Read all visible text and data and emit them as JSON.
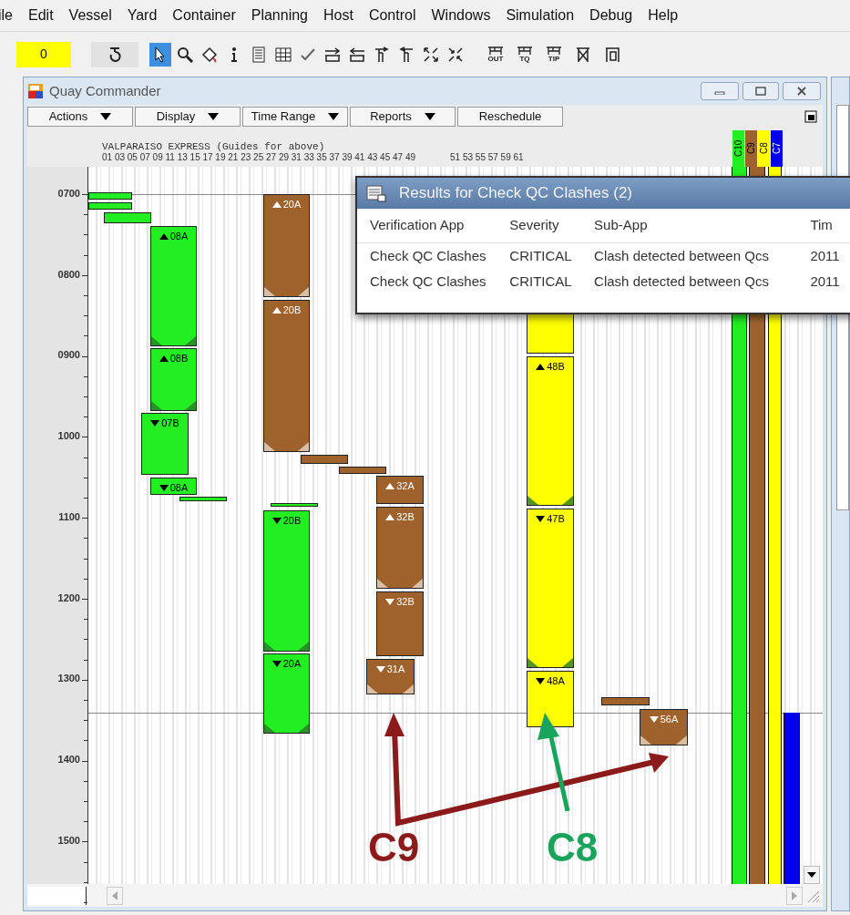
{
  "menu_bar": [
    "ile",
    "Edit",
    "Vessel",
    "Yard",
    "Container",
    "Planning",
    "Host",
    "Control",
    "Windows",
    "Simulation",
    "Debug",
    "Help"
  ],
  "toolbar": {
    "counter": "0",
    "tools": [
      {
        "kind": "pointer",
        "selected": true
      },
      {
        "kind": "search",
        "selected": false
      },
      {
        "kind": "paint",
        "selected": false
      },
      {
        "kind": "info",
        "selected": false
      },
      {
        "kind": "list",
        "selected": false
      },
      {
        "kind": "grid",
        "selected": false
      },
      {
        "kind": "check",
        "selected": false
      },
      {
        "kind": "shift-right",
        "selected": false
      },
      {
        "kind": "shift-left",
        "selected": false
      },
      {
        "kind": "crane-right",
        "selected": false
      },
      {
        "kind": "crane-left",
        "selected": false
      },
      {
        "kind": "expand",
        "selected": false
      },
      {
        "kind": "collapse",
        "selected": false
      },
      {
        "kind": "crane",
        "caption": "OUT",
        "selected": false
      },
      {
        "kind": "crane",
        "caption": "TQ",
        "selected": false
      },
      {
        "kind": "crane",
        "caption": "TIP",
        "selected": false
      },
      {
        "kind": "crane-cross",
        "selected": false
      },
      {
        "kind": "gate",
        "selected": false
      }
    ]
  },
  "window": {
    "title": "Quay Commander",
    "menu_buttons": [
      {
        "label": "Actions",
        "dropdown": true
      },
      {
        "label": "Display",
        "dropdown": true
      },
      {
        "label": "Time Range",
        "dropdown": true
      },
      {
        "label": "Reports",
        "dropdown": true
      },
      {
        "label": "Reschedule",
        "dropdown": false
      }
    ],
    "vessel_header": "VALPARAISO EXPRESS (Guides for above)",
    "bay_numbers": [
      "01 03 05 07 09 11 13 15 17 19 21 23 25 27 29 31 33 35 37 39 41 43 45 47 49",
      "51 53 55 57 59 61"
    ],
    "cranes": [
      {
        "label": "C10",
        "color": "#22ee22"
      },
      {
        "label": "C9",
        "color": "#a0622d"
      },
      {
        "label": "C8",
        "color": "#ffff00"
      },
      {
        "label": "C7",
        "color": "#0000ee"
      }
    ],
    "time_axis": [
      "0700",
      "0800",
      "0900",
      "1000",
      "1100",
      "1200",
      "1300",
      "1400",
      "1500"
    ],
    "blocks": [
      {
        "color": "#22ee22",
        "hatched": false
      },
      {
        "color": "#22ee22",
        "hatched": false
      },
      {
        "color": "#22ee22",
        "hatched": false
      },
      {
        "color": "#22ee22",
        "label": "08A",
        "up": true,
        "hatched": true
      },
      {
        "color": "#22ee22",
        "label": "08B",
        "up": true,
        "hatched": true
      },
      {
        "color": "#22ee22",
        "label": "07B",
        "up": false,
        "hatched": false
      },
      {
        "color": "#22ee22",
        "label": "08A",
        "up": false,
        "hatched": false
      },
      {
        "color": "#22ee22",
        "hatched": false
      },
      {
        "color": "#a0622d",
        "label": "20A",
        "up": true,
        "hatched": true
      },
      {
        "color": "#a0622d",
        "label": "20B",
        "up": true,
        "hatched": true
      },
      {
        "color": "#a0622d",
        "hatched": false
      },
      {
        "color": "#a0622d",
        "hatched": false
      },
      {
        "color": "#22ee22",
        "hatched": false
      },
      {
        "color": "#22ee22",
        "label": "20B",
        "up": false,
        "hatched": true
      },
      {
        "color": "#22ee22",
        "label": "20A",
        "up": false,
        "hatched": true
      },
      {
        "color": "#a0622d",
        "label": "32A",
        "up": true,
        "hatched": false
      },
      {
        "color": "#a0622d",
        "label": "32B",
        "up": true,
        "hatched": true
      },
      {
        "color": "#a0622d",
        "label": "32B",
        "up": false,
        "hatched": false
      },
      {
        "color": "#a0622d",
        "label": "31A",
        "up": false,
        "hatched": true
      },
      {
        "color": "#ffff00",
        "hatched": false
      },
      {
        "color": "#ffff00",
        "label": "48B",
        "up": true,
        "hatched": true
      },
      {
        "color": "#ffff00",
        "label": "47B",
        "up": false,
        "hatched": true
      },
      {
        "color": "#ffff00",
        "label": "48A",
        "up": false,
        "hatched": false
      },
      {
        "color": "#a0622d",
        "hatched": false
      },
      {
        "color": "#a0622d",
        "label": "56A",
        "up": false,
        "hatched": true
      }
    ],
    "crane_tracks": [
      {
        "color": "#22ee22"
      },
      {
        "color": "#a0622d"
      },
      {
        "color": "#ffff00"
      },
      {
        "color": "#0000ee"
      }
    ]
  },
  "results_dialog": {
    "title": "Results for Check QC Clashes (2)",
    "columns": [
      "Verification App",
      "Severity",
      "Sub-App",
      "Tim"
    ],
    "rows": [
      [
        "Check QC Clashes",
        "CRITICAL",
        "Clash detected between Qcs",
        "2011"
      ],
      [
        "Check QC Clashes",
        "CRITICAL",
        "Clash detected between Qcs",
        "2011"
      ]
    ]
  },
  "annotations": [
    {
      "label": "C9",
      "color": "#8b1a1a"
    },
    {
      "label": "C8",
      "color": "#1aa35a"
    }
  ]
}
